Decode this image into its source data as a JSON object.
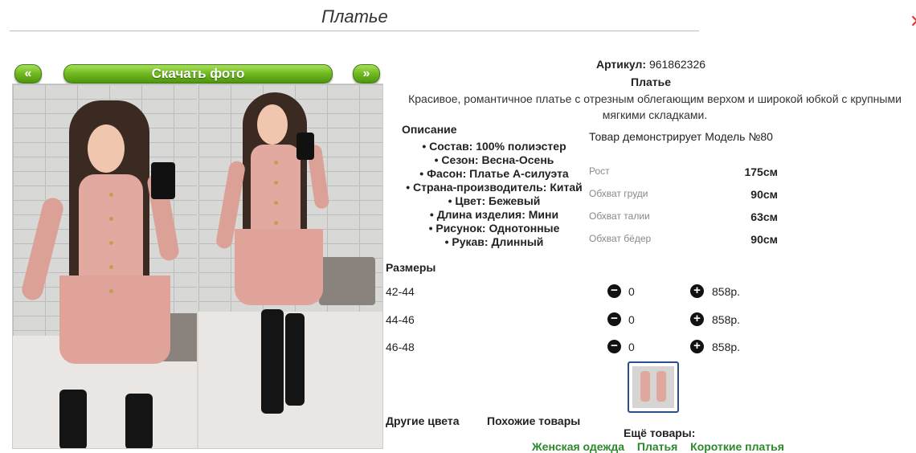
{
  "header": {
    "title": "Платье"
  },
  "gallery": {
    "prev_label": "«",
    "next_label": "»",
    "download_label": "Скачать фото"
  },
  "product": {
    "article_label": "Артикул:",
    "article_value": "961862326",
    "name": "Платье",
    "description": "Красивое, романтичное платье с отрезным облегающим верхом и широкой юбкой с крупными мягкими складками."
  },
  "specs": {
    "title": "Описание",
    "items": [
      "Состав: 100% полиэстер",
      "Сезон: Весна-Осень",
      "Фасон: Платье А-силуэта",
      "Страна-производитель: Китай",
      "Цвет: Бежевый",
      "Длина изделия: Мини",
      "Рисунок: Однотонные",
      "Рукав: Длинный"
    ]
  },
  "model": {
    "text": "Товар демонстрирует Модель №80",
    "measurements": [
      {
        "label": "Рост",
        "value": "175см"
      },
      {
        "label": "Обхват груди",
        "value": "90см"
      },
      {
        "label": "Обхват талии",
        "value": "63см"
      },
      {
        "label": "Обхват бёдер",
        "value": "90см"
      }
    ]
  },
  "sizes": {
    "title": "Размеры",
    "rows": [
      {
        "name": "42-44",
        "qty": "0",
        "price": "858р.",
        "minus": "−",
        "plus": "+"
      },
      {
        "name": "44-46",
        "qty": "0",
        "price": "858р.",
        "minus": "−",
        "plus": "+"
      },
      {
        "name": "46-48",
        "qty": "0",
        "price": "858р.",
        "minus": "−",
        "plus": "+"
      }
    ]
  },
  "footer": {
    "other_colors": "Другие цвета",
    "similar": "Похожие товары",
    "more": "Ещё товары:",
    "categories": [
      "Женская одежда",
      "Платья",
      "Короткие платья"
    ]
  },
  "colors": {
    "button_green": "#6fb81f",
    "link_green": "#2a8a2a",
    "close_red": "#dd3333"
  },
  "icons": {
    "close": "close-icon",
    "minus": "minus-circle-icon",
    "plus": "plus-circle-icon"
  }
}
